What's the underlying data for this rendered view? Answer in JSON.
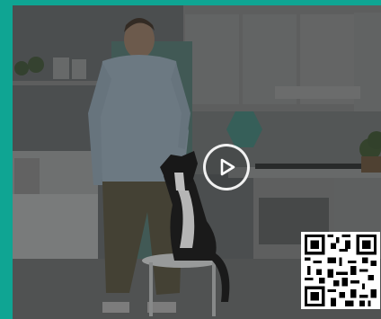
{
  "colors": {
    "frame_accent": "#0fa593",
    "overlay": "rgba(0,0,0,0.38)",
    "play_icon": "#ffffff"
  },
  "video": {
    "state": "paused",
    "scene_description_icon": "video-thumbnail"
  },
  "controls": {
    "play_icon": "play-icon"
  },
  "qr": {
    "icon": "qr-code-icon"
  }
}
